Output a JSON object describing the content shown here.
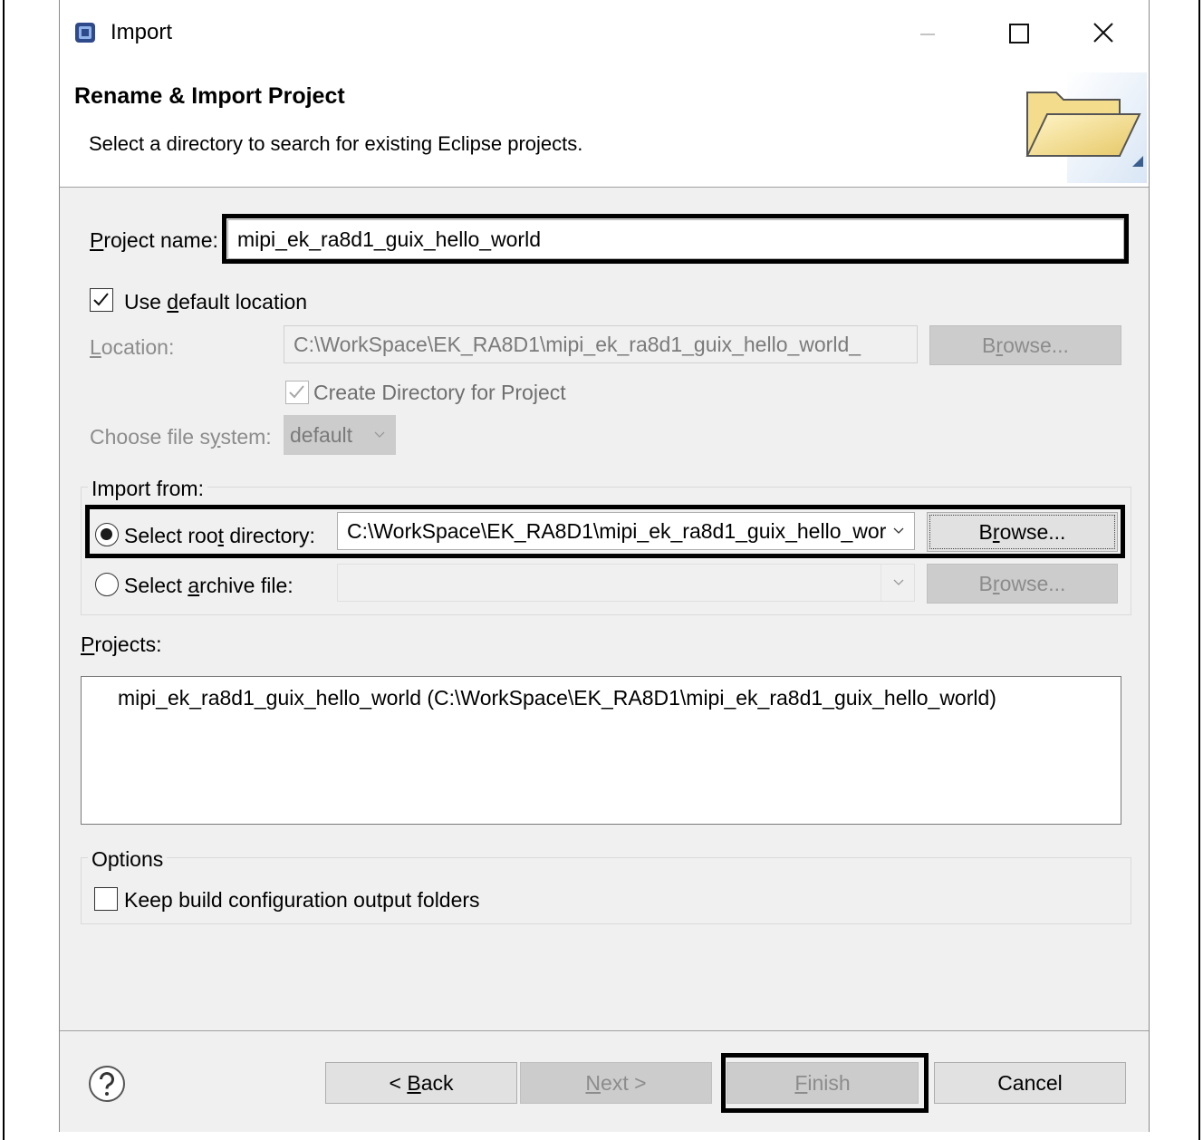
{
  "window": {
    "title": "Import"
  },
  "header": {
    "title": "Rename & Import Project",
    "description": "Select a directory to search for existing Eclipse projects."
  },
  "project_name": {
    "label": "roject name:",
    "label_mnemonic": "P",
    "value": "mipi_ek_ra8d1_guix_hello_world"
  },
  "use_default_location": {
    "label_pre": "Use ",
    "label_mnemonic": "d",
    "label_post": "efault location",
    "checked": true
  },
  "location": {
    "label_mnemonic": "L",
    "label": "ocation:",
    "value": "C:\\WorkSpace\\EK_RA8D1\\mipi_ek_ra8d1_guix_hello_world_",
    "browse_pre": "B",
    "browse_mnemonic": "r",
    "browse_post": "owse..."
  },
  "create_directory": {
    "label": "Create Directory for Project",
    "checked": true
  },
  "file_system": {
    "label_pre": "Choose file s",
    "label_mnemonic": "y",
    "label_post": "stem:",
    "value": "default"
  },
  "import_from": {
    "title": "Import from:",
    "root_directory": {
      "label_pre": "Select roo",
      "label_mnemonic": "t",
      "label_post": " directory:",
      "value": "C:\\WorkSpace\\EK_RA8D1\\mipi_ek_ra8d1_guix_hello_wor",
      "browse_pre": "B",
      "browse_mnemonic": "r",
      "browse_post": "owse...",
      "selected": true
    },
    "archive_file": {
      "label_pre": "Select ",
      "label_mnemonic": "a",
      "label_post": "rchive file:",
      "value": "",
      "browse_pre": "B",
      "browse_mnemonic": "r",
      "browse_post": "owse...",
      "selected": false
    }
  },
  "projects": {
    "label_mnemonic": "P",
    "label": "rojects:",
    "items": [
      "mipi_ek_ra8d1_guix_hello_world (C:\\WorkSpace\\EK_RA8D1\\mipi_ek_ra8d1_guix_hello_world)"
    ]
  },
  "options": {
    "title": "Options",
    "keep_build": {
      "label": "Keep build configuration output folders",
      "checked": false
    }
  },
  "footer": {
    "back": {
      "pre": "< ",
      "mnemonic": "B",
      "post": "ack"
    },
    "next": {
      "mnemonic": "N",
      "post": "ext >"
    },
    "finish": {
      "mnemonic": "F",
      "post": "inish"
    },
    "cancel": "Cancel"
  },
  "icons": {
    "app": "eclipse-app-icon",
    "header": "open-folder-icon",
    "help": "help-icon"
  }
}
